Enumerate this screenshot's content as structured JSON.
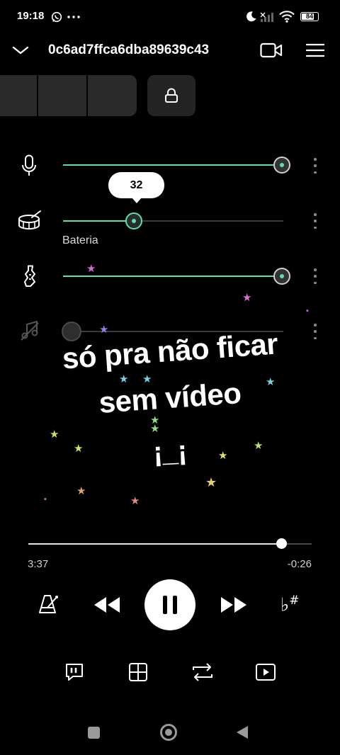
{
  "status_bar": {
    "time": "19:18",
    "battery": "84",
    "battery_level_percent": 84
  },
  "header": {
    "title": "0c6ad7ffca6dba89639c43"
  },
  "tracks": [
    {
      "icon": "microphone-icon",
      "value_percent": 100,
      "muted": false
    },
    {
      "icon": "drum-icon",
      "value": 32,
      "value_label": "32",
      "label": "Bateria",
      "muted": false
    },
    {
      "icon": "guitar-icon",
      "value_percent": 100,
      "muted": false
    },
    {
      "icon": "bass-muted-icon",
      "value_percent": 0,
      "muted": true
    }
  ],
  "overlay_caption": {
    "line1": "só pra não ficar",
    "line2": "sem vídeo",
    "line3": "¡_¡"
  },
  "playback": {
    "elapsed": "3:37",
    "remaining": "-0:26",
    "progress_fraction": 0.893,
    "state": "playing"
  },
  "colors": {
    "accent": "#55e0b6",
    "background": "#000000"
  }
}
